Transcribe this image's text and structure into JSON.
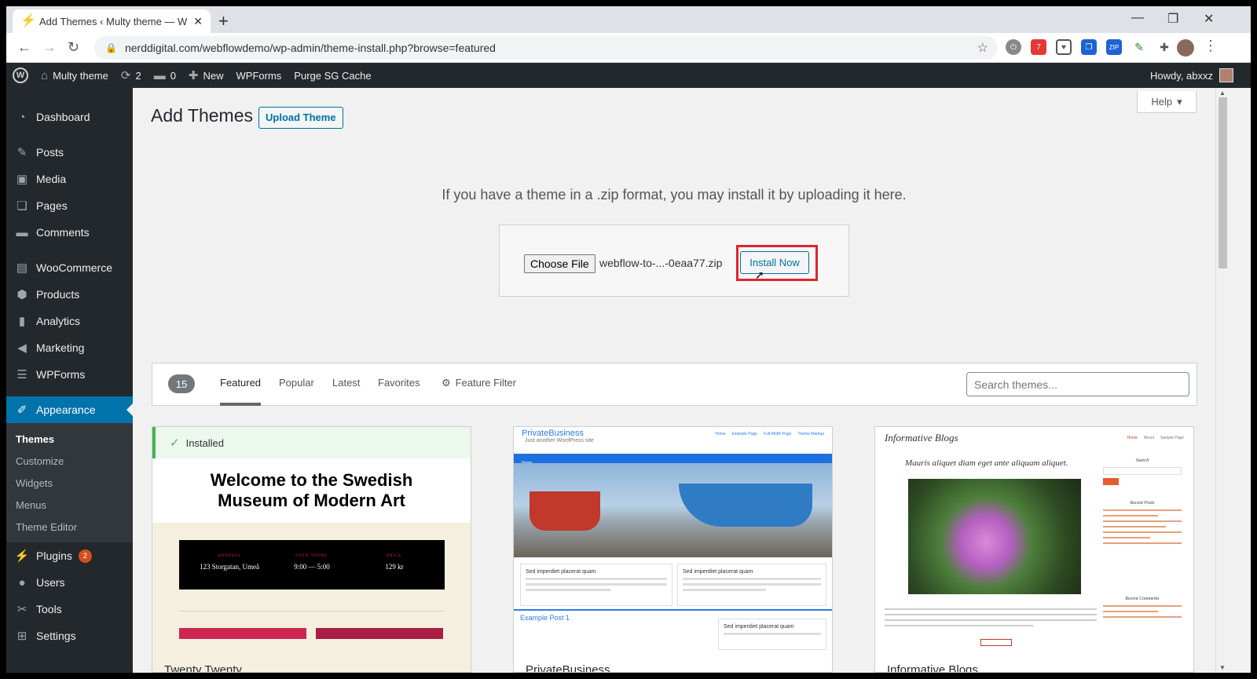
{
  "browser": {
    "tab_title": "Add Themes ‹ Multy theme — W",
    "url": "nerddigital.com/webflowdemo/wp-admin/theme-install.php?browse=featured",
    "ext_badge": "7",
    "ext_zip": "ZIP"
  },
  "adminbar": {
    "site_name": "Multy theme",
    "updates_count": "2",
    "comments_count": "0",
    "new_label": "New",
    "wpforms_label": "WPForms",
    "purge_label": "Purge SG Cache",
    "howdy": "Howdy, abxxz"
  },
  "sidebar": {
    "dashboard": "Dashboard",
    "posts": "Posts",
    "media": "Media",
    "pages": "Pages",
    "comments": "Comments",
    "woocommerce": "WooCommerce",
    "products": "Products",
    "analytics": "Analytics",
    "marketing": "Marketing",
    "wpforms": "WPForms",
    "appearance": "Appearance",
    "sub_themes": "Themes",
    "sub_customize": "Customize",
    "sub_widgets": "Widgets",
    "sub_menus": "Menus",
    "sub_theme_editor": "Theme Editor",
    "plugins": "Plugins",
    "plugins_badge": "2",
    "users": "Users",
    "tools": "Tools",
    "settings": "Settings"
  },
  "main": {
    "title": "Add Themes",
    "upload_button": "Upload Theme",
    "help_label": "Help",
    "upload_description": "If you have a theme in a .zip format, you may install it by uploading it here.",
    "choose_file_label": "Choose File",
    "file_name": "webflow-to-...-0eaa77.zip",
    "install_now_label": "Install Now",
    "theme_count": "15",
    "tabs": {
      "featured": "Featured",
      "popular": "Popular",
      "latest": "Latest",
      "favorites": "Favorites",
      "feature_filter": "Feature Filter"
    },
    "search_placeholder": "Search themes..."
  },
  "themes": [
    {
      "name": "Twenty Twenty",
      "installed_label": "Installed",
      "hero_line1": "Welcome to the Swedish",
      "hero_line2": "Museum of Modern Art",
      "info_address_label": "ADDRESS",
      "info_address": "123 Storgatan, Umeå",
      "info_open_label": "OPEN TODAY",
      "info_open": "9:00 — 5:00",
      "info_price_label": "PRICE",
      "info_price": "129 kr"
    },
    {
      "name": "PrivateBusiness",
      "brand": "PrivateBusiness",
      "tagline": "Just another WordPress site",
      "nav": [
        "Home",
        "Example Page",
        "Full Width Page",
        "Theme Markup"
      ],
      "post_title": "Sed imperdiet placerat quam",
      "example_post": "Example Post 1"
    },
    {
      "name": "Informative Blogs",
      "site_title": "Informative Blogs",
      "nav": [
        "Home",
        "About",
        "Sample Page"
      ],
      "post_heading": "Mauris aliquet diam eget ante aliquam aliquet.",
      "side_search": "Search",
      "side_recent_posts": "Recent Posts",
      "side_recent_comments": "Recent Comments"
    }
  ]
}
